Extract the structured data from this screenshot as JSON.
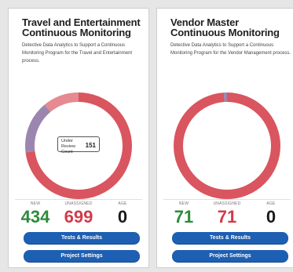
{
  "colors": {
    "ring_red": "#d9555f",
    "ring_light_red": "#e48a90",
    "ring_purple": "#9c86b0",
    "new_green": "#2e8b3a",
    "unassigned_red": "#d23a4a",
    "button_blue": "#1d5fb3"
  },
  "cards": [
    {
      "title": "Travel and Entertainment Continuous Monitoring",
      "description": "Detective Data Analytics to Support a Continuous Monitoring Program for the Travel and Entertainment process.",
      "tooltip": {
        "label": "Under Review Count",
        "value": "151"
      },
      "donut_segments": [
        {
          "status": "unassigned",
          "fraction": 0.73,
          "color": "#d9555f"
        },
        {
          "status": "under-review",
          "fraction": 0.16,
          "color": "#9c86b0"
        },
        {
          "status": "other",
          "fraction": 0.11,
          "color": "#e48a90"
        }
      ],
      "stats": {
        "new_label": "NEW",
        "new_value": "434",
        "unassigned_label": "UNASSIGNED",
        "unassigned_value": "699",
        "age_label": "AGE",
        "age_value": "0"
      },
      "buttons": {
        "tests": "Tests & Results",
        "settings": "Project Settings"
      }
    },
    {
      "title": "Vendor Master Continuous Monitoring",
      "description": "Detective Data Analytics to Support a Continuous Monitoring Program for the Vendor Management process.",
      "donut_segments": [
        {
          "status": "unassigned",
          "fraction": 0.99,
          "color": "#d9555f"
        },
        {
          "status": "under-review",
          "fraction": 0.01,
          "color": "#9c86b0"
        }
      ],
      "stats": {
        "new_label": "NEW",
        "new_value": "71",
        "unassigned_label": "UNASSIGNED",
        "unassigned_value": "71",
        "age_label": "AGE",
        "age_value": "0"
      },
      "buttons": {
        "tests": "Tests & Results",
        "settings": "Project Settings"
      }
    }
  ]
}
